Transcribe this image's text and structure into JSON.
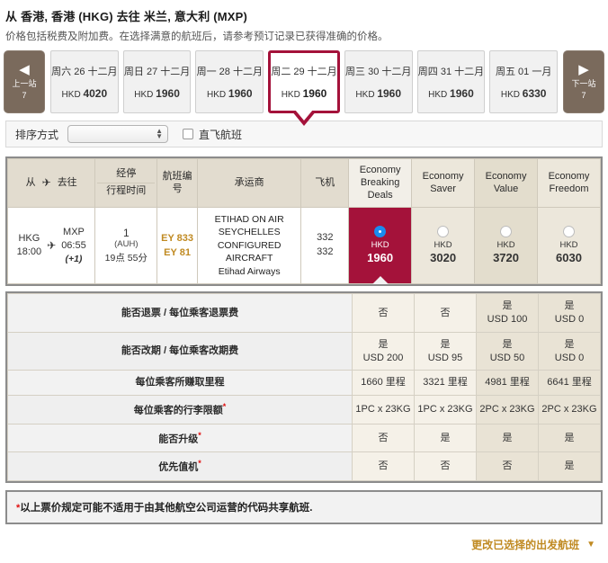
{
  "header": {
    "title": "从 香港, 香港 (HKG) 去往 米兰, 意大利 (MXP)",
    "subtitle": "价格包括税费及附加费。在选择满意的航班后，请参考预订记录已获得准确的价格。"
  },
  "date_strip": {
    "prev": {
      "label": "上一站",
      "count": "7",
      "icon": "triangle-left-icon"
    },
    "next": {
      "label": "下一站",
      "count": "7",
      "icon": "triangle-right-icon"
    },
    "dates": [
      {
        "day": "周六 26 十二月",
        "currency": "HKD",
        "price": "4020",
        "selected": false
      },
      {
        "day": "周日 27 十二月",
        "currency": "HKD",
        "price": "1960",
        "selected": false
      },
      {
        "day": "周一 28 十二月",
        "currency": "HKD",
        "price": "1960",
        "selected": false
      },
      {
        "day": "周二 29 十二月",
        "currency": "HKD",
        "price": "1960",
        "selected": true
      },
      {
        "day": "周三 30 十二月",
        "currency": "HKD",
        "price": "1960",
        "selected": false
      },
      {
        "day": "周四 31 十二月",
        "currency": "HKD",
        "price": "1960",
        "selected": false
      },
      {
        "day": "周五 01 一月",
        "currency": "HKD",
        "price": "6330",
        "selected": false
      }
    ]
  },
  "sortbar": {
    "label": "排序方式",
    "select_value": "",
    "checkbox_label": "直飞航班",
    "checkbox_checked": false
  },
  "table": {
    "headers": {
      "from": "从",
      "to": "去往",
      "plane_icon": "airplane-icon",
      "stops": "经停",
      "duration": "行程时间",
      "flight_no": "航班编号",
      "carrier": "承运商",
      "aircraft": "飞机",
      "fares": [
        "Economy Breaking Deals",
        "Economy Saver",
        "Economy Value",
        "Economy Freedom"
      ]
    },
    "flight": {
      "origin_code": "HKG",
      "origin_time": "18:00",
      "dest_code": "MXP",
      "dest_time": "06:55",
      "dest_day_offset": "(+1)",
      "stops_count": "1",
      "stops_via": "(AUH)",
      "duration": "19点 55分",
      "flight_numbers": [
        "EY 833",
        "EY 81"
      ],
      "carrier_lines": [
        "ETIHAD ON AIR",
        "SEYCHELLES",
        "CONFIGURED",
        "AIRCRAFT"
      ],
      "carrier_operator": "Etihad Airways",
      "aircraft": [
        "332",
        "332"
      ],
      "fares": [
        {
          "currency": "HKD",
          "amount": "1960",
          "selected": true
        },
        {
          "currency": "HKD",
          "amount": "3020",
          "selected": false
        },
        {
          "currency": "HKD",
          "amount": "3720",
          "selected": false
        },
        {
          "currency": "HKD",
          "amount": "6030",
          "selected": false
        }
      ]
    }
  },
  "rules": [
    {
      "label": "能否退票 / 每位乘客退票费",
      "asterisk": false,
      "values": [
        {
          "main": "否",
          "sub": ""
        },
        {
          "main": "否",
          "sub": ""
        },
        {
          "main": "是",
          "sub": "USD 100"
        },
        {
          "main": "是",
          "sub": "USD 0"
        }
      ]
    },
    {
      "label": "能否改期 / 每位乘客改期费",
      "asterisk": false,
      "values": [
        {
          "main": "是",
          "sub": "USD 200"
        },
        {
          "main": "是",
          "sub": "USD 95"
        },
        {
          "main": "是",
          "sub": "USD 50"
        },
        {
          "main": "是",
          "sub": "USD 0"
        }
      ]
    },
    {
      "label": "每位乘客所赚取里程",
      "asterisk": false,
      "values": [
        {
          "main": "1660 里程",
          "sub": ""
        },
        {
          "main": "3321 里程",
          "sub": ""
        },
        {
          "main": "4981 里程",
          "sub": ""
        },
        {
          "main": "6641 里程",
          "sub": ""
        }
      ]
    },
    {
      "label": "每位乘客的行李限额",
      "asterisk": true,
      "values": [
        {
          "main": "1PC x 23KG",
          "sub": ""
        },
        {
          "main": "1PC x 23KG",
          "sub": ""
        },
        {
          "main": "2PC x 23KG",
          "sub": ""
        },
        {
          "main": "2PC x 23KG",
          "sub": ""
        }
      ]
    },
    {
      "label": "能否升级",
      "asterisk": true,
      "values": [
        {
          "main": "否",
          "sub": ""
        },
        {
          "main": "是",
          "sub": ""
        },
        {
          "main": "是",
          "sub": ""
        },
        {
          "main": "是",
          "sub": ""
        }
      ]
    },
    {
      "label": "优先值机",
      "asterisk": true,
      "values": [
        {
          "main": "否",
          "sub": ""
        },
        {
          "main": "否",
          "sub": ""
        },
        {
          "main": "否",
          "sub": ""
        },
        {
          "main": "是",
          "sub": ""
        }
      ]
    }
  ],
  "footnote": {
    "asterisk": "*",
    "text": "以上票价规定可能不适用于由其他航空公司运营的代码共享航班."
  },
  "bottom_link": {
    "label": "更改已选择的出发航班",
    "caret": "▼"
  },
  "colors": {
    "accent_red": "#a4123a",
    "gold": "#c08a22",
    "brown": "#7a6a5c",
    "radio_blue": "#1a8cf0"
  }
}
